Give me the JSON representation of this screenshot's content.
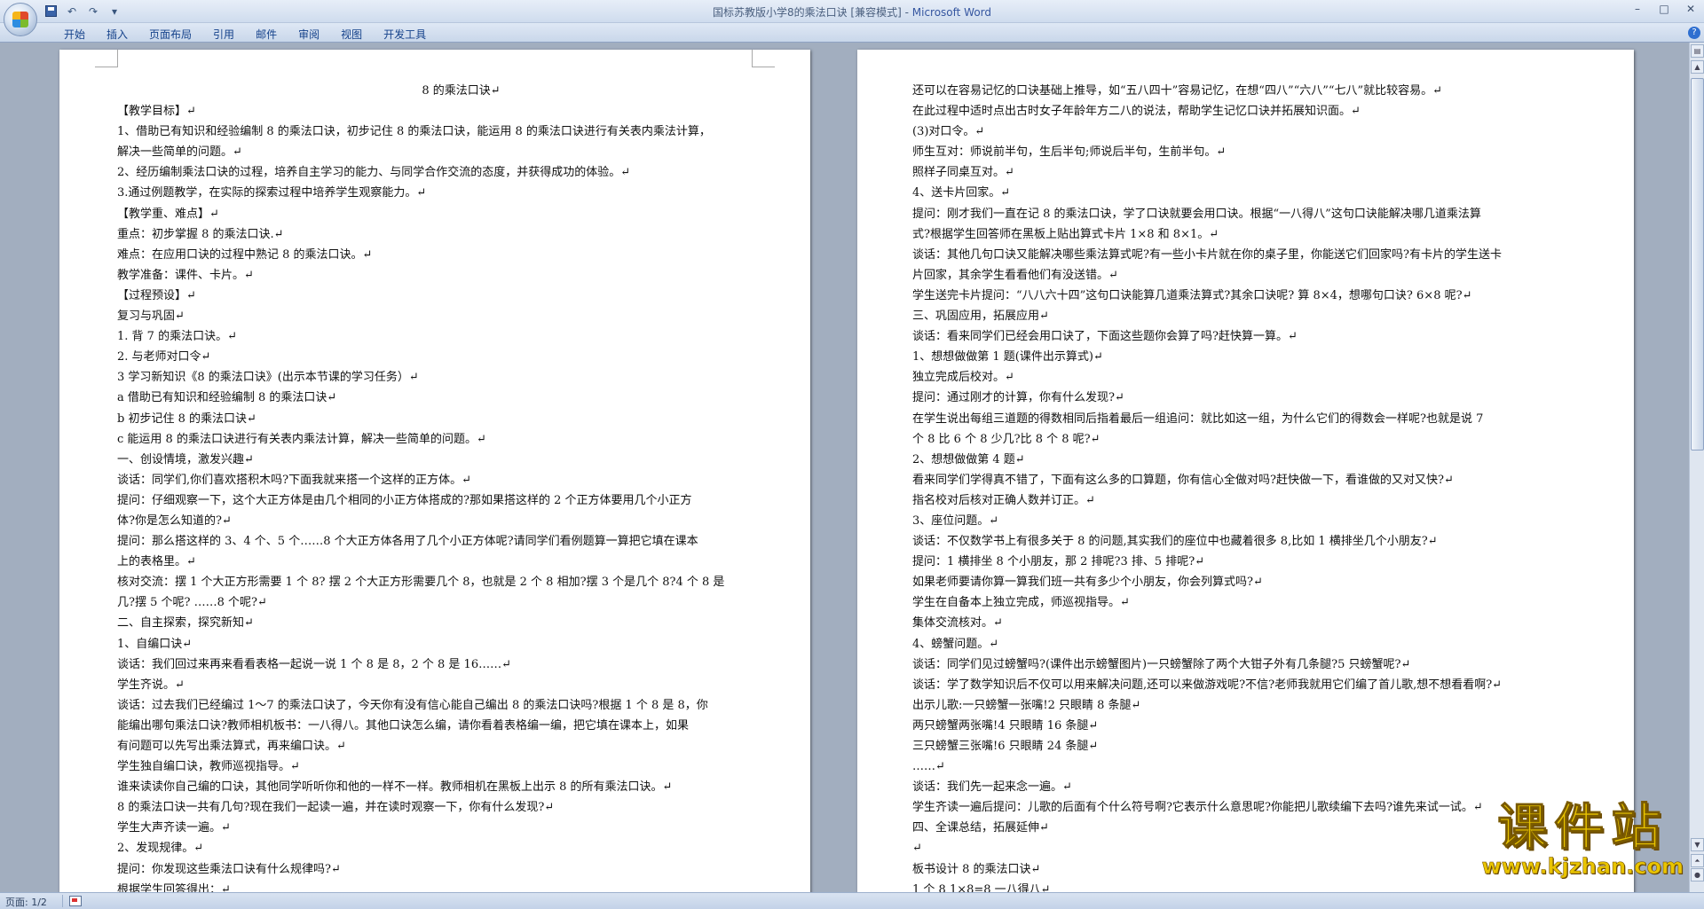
{
  "window": {
    "title": "国标苏教版小学8的乘法口诀 [兼容模式]",
    "app_name": "Microsoft Word",
    "controls": [
      "–",
      "□",
      "✕"
    ]
  },
  "quick_access": {
    "undo": "↶",
    "redo": "↷",
    "more": "▾"
  },
  "ribbon": {
    "tabs": [
      "开始",
      "插入",
      "页面布局",
      "引用",
      "邮件",
      "审阅",
      "视图",
      "开发工具"
    ],
    "help": "?"
  },
  "pages": {
    "left": [
      "8 的乘法口诀↵",
      "【教学目标】↵",
      "1、借助已有知识和经验编制 8 的乘法口诀，初步记住 8 的乘法口诀，能运用 8 的乘法口诀进行有关表内乘法计算，",
      "解决一些简单的问题。↵",
      "2、经历编制乘法口诀的过程，培养自主学习的能力、与同学合作交流的态度，并获得成功的体验。↵",
      "3.通过例题教学，在实际的探索过程中培养学生观察能力。↵",
      "【教学重、难点】↵",
      "重点：初步掌握 8 的乘法口诀.↵",
      "难点：在应用口诀的过程中熟记 8 的乘法口诀。↵",
      "教学准备：课件、卡片。↵",
      "【过程预设】↵",
      "复习与巩固↵",
      "1.   背 7 的乘法口诀。↵",
      "2.   与老师对口令↵",
      "3 学习新知识《8 的乘法口诀》(出示本节课的学习任务）↵",
      "a 借助已有知识和经验编制 8 的乘法口诀↵",
      "b 初步记住 8 的乘法口诀↵",
      "c 能运用 8 的乘法口诀进行有关表内乘法计算，解决一些简单的问题。↵",
      "一、创设情境，激发兴趣↵",
      "谈话：同学们,你们喜欢搭积木吗?下面我就来搭一个这样的正方体。↵",
      "提问：仔细观察一下，这个大正方体是由几个相同的小正方体搭成的?那如果搭这样的  2  个正方体要用几个小正方",
      "体?你是怎么知道的?↵",
      "提问：那么搭这样的 3、4 个、5 个……8 个大正方体各用了几个小正方体呢?请同学们看例题算一算把它填在课本",
      "上的表格里。↵",
      "核对交流：摆 1 个大正方形需要 1 个 8?  摆 2 个大正方形需要几个 8，也就是 2 个 8 相加?摆 3 个是几个 8?4 个 8 是",
      "几?摆 5 个呢?  ……8 个呢?↵",
      "二、自主探索，探究新知↵",
      "1、自编口诀↵",
      "谈话：我们回过来再来看看表格一起说一说 1 个 8 是 8，2 个 8 是 16……↵",
      "学生齐说。↵",
      "谈话：过去我们已经编过 1～7 的乘法口诀了，今天你有没有信心能自己编出 8 的乘法口诀吗?根据 1 个 8 是 8，你",
      "能编出哪句乘法口诀?教师相机板书：一八得八。其他口诀怎么编，请你看着表格编一编，把它填在课本上，如果",
      "有问题可以先写出乘法算式，再来编口诀。↵",
      "学生独自编口诀，教师巡视指导。↵",
      "谁来读读你自己编的口诀，其他同学听听你和他的一样不一样。教师相机在黑板上出示 8 的所有乘法口诀。↵",
      "8 的乘法口诀一共有几句?现在我们一起读一遍，并在读时观察一下，你有什么发现?↵",
      "学生大声齐读一遍。↵",
      "2、发现规律。↵",
      "提问：你发现这些乘法口诀有什么规律吗?↵",
      "根据学生回答得出：↵"
    ],
    "right": [
      "还可以在容易记忆的口诀基础上推导，如“五八四十”容易记忆，在想“四八”“六八”“七八”就比较容易。↵",
      "在此过程中适时点出古时女子年龄年方二八的说法，帮助学生记忆口诀并拓展知识面。↵",
      "(3)对口令。↵",
      "师生互对：师说前半句，生后半句;师说后半句，生前半句。↵",
      "照样子同桌互对。↵",
      "4、送卡片回家。↵",
      "提问：刚才我们一直在记 8 的乘法口诀，学了口诀就要会用口诀。根据“一八得八”这句口诀能解决哪几道乘法算",
      "式?根据学生回答师在黑板上贴出算式卡片 1×8 和 8×1。↵",
      "谈话：其他几句口诀又能解决哪些乘法算式呢?有一些小卡片就在你的桌子里，你能送它们回家吗?有卡片的学生送卡",
      "片回家，其余学生看看他们有没送错。↵",
      "学生送完卡片提问：“八八六十四”这句口诀能算几道乘法算式?其余口诀呢?  算 8×4，想哪句口诀? 6×8 呢?↵",
      "三、巩固应用，拓展应用↵",
      "谈话：看来同学们已经会用口诀了，下面这些题你会算了吗?赶快算一算。↵",
      "1、想想做做第 1 题(课件出示算式)↵",
      "独立完成后校对。↵",
      "提问：通过刚才的计算，你有什么发现?↵",
      "在学生说出每组三道题的得数相同后指着最后一组追问：就比如这一组，为什么它们的得数会一样呢?也就是说  7",
      "个 8 比 6 个 8 少几?比 8 个 8 呢?↵",
      "2、想想做做第 4 题↵",
      "看来同学们学得真不错了，下面有这么多的口算题，你有信心全做对吗?赶快做一下，看谁做的又对又快?↵",
      "指名校对后核对正确人数并订正。↵",
      "3、座位问题。↵",
      "谈话：不仅数学书上有很多关于 8 的问题,其实我们的座位中也藏着很多 8,比如 1 横排坐几个小朋友?↵",
      "提问：1 横排坐 8 个小朋友，那 2 排呢?3 排、5 排呢?↵",
      "如果老师要请你算一算我们班一共有多少个小朋友，你会列算式吗?↵",
      "学生在自备本上独立完成，师巡视指导。↵",
      "集体交流核对。↵",
      "4、螃蟹问题。↵",
      "谈话：同学们见过螃蟹吗?(课件出示螃蟹图片)一只螃蟹除了两个大钳子外有几条腿?5 只螃蟹呢?↵",
      "谈话：学了数学知识后不仅可以用来解决问题,还可以来做游戏呢?不信?老师我就用它们编了首儿歌,想不想看看啊?↵",
      "出示儿歌:一只螃蟹一张嘴!2 只眼睛 8 条腿↵",
      "两只螃蟹两张嘴!4 只眼睛 16 条腿↵",
      "三只螃蟹三张嘴!6 只眼睛 24 条腿↵",
      "……↵",
      "谈话：我们先一起来念一遍。↵",
      "学生齐读一遍后提问：儿歌的后面有个什么符号啊?它表示什么意思呢?你能把儿歌续编下去吗?谁先来试一试。↵",
      "四、全课总结，拓展延伸↵",
      "↵",
      "板书设计                              8 的乘法口诀↵",
      "                                  1 个 8                         1×8=8          一八得八↵"
    ]
  },
  "statusbar": {
    "page_info": "页面: 1/2"
  },
  "watermark": {
    "title": "课件站",
    "url": "www.kjzhan.com"
  }
}
